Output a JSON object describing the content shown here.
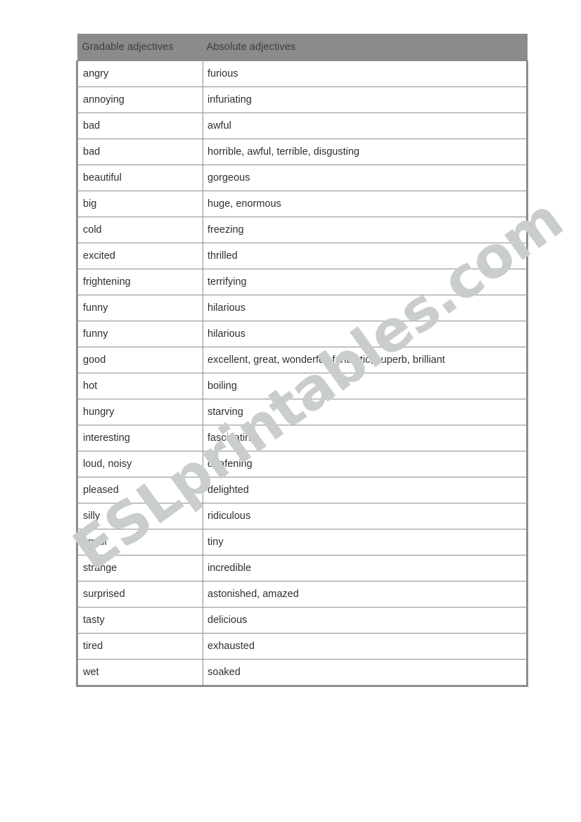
{
  "worksheet": {
    "watermark": "ESLprintables.com",
    "watermark_color": "#c9cdcc",
    "header_background_color": "#8b8b8b",
    "border_color": "#8d8d8d",
    "text_color": "#2f2f35",
    "page_background_color": "#ffffff"
  },
  "table": {
    "columns": [
      {
        "key": "gradable",
        "label": "Gradable adjectives"
      },
      {
        "key": "absolute",
        "label": "Absolute adjectives"
      }
    ],
    "rows": [
      {
        "gradable": "angry",
        "absolute": "furious"
      },
      {
        "gradable": "annoying",
        "absolute": "infuriating"
      },
      {
        "gradable": "bad",
        "absolute": "awful"
      },
      {
        "gradable": "bad",
        "absolute": "horrible, awful, terrible, disgusting"
      },
      {
        "gradable": "beautiful",
        "absolute": "gorgeous"
      },
      {
        "gradable": "big",
        "absolute": "huge, enormous"
      },
      {
        "gradable": "cold",
        "absolute": "freezing"
      },
      {
        "gradable": "excited",
        "absolute": "thrilled"
      },
      {
        "gradable": "frightening",
        "absolute": "terrifying"
      },
      {
        "gradable": "funny",
        "absolute": "hilarious"
      },
      {
        "gradable": "funny",
        "absolute": "hilarious"
      },
      {
        "gradable": "good",
        "absolute": "excellent, great, wonderful, fantastic, superb, brilliant"
      },
      {
        "gradable": "hot",
        "absolute": "boiling"
      },
      {
        "gradable": "hungry",
        "absolute": "starving"
      },
      {
        "gradable": "interesting",
        "absolute": "fascinating"
      },
      {
        "gradable": "loud, noisy",
        "absolute": "deafening"
      },
      {
        "gradable": "pleased",
        "absolute": "delighted"
      },
      {
        "gradable": "silly",
        "absolute": "ridiculous"
      },
      {
        "gradable": "small",
        "absolute": "tiny"
      },
      {
        "gradable": "strange",
        "absolute": "incredible"
      },
      {
        "gradable": "surprised",
        "absolute": "astonished, amazed"
      },
      {
        "gradable": "tasty",
        "absolute": "delicious"
      },
      {
        "gradable": "tired",
        "absolute": "exhausted"
      },
      {
        "gradable": "wet",
        "absolute": "soaked"
      }
    ]
  }
}
